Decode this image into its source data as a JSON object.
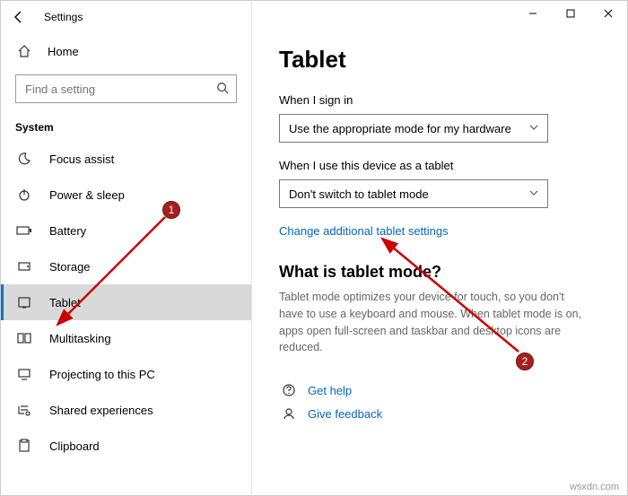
{
  "header": {
    "app_title": "Settings"
  },
  "home_label": "Home",
  "search": {
    "placeholder": "Find a setting"
  },
  "section_label": "System",
  "sidebar": {
    "items": [
      {
        "label": "Focus assist"
      },
      {
        "label": "Power & sleep"
      },
      {
        "label": "Battery"
      },
      {
        "label": "Storage"
      },
      {
        "label": "Tablet"
      },
      {
        "label": "Multitasking"
      },
      {
        "label": "Projecting to this PC"
      },
      {
        "label": "Shared experiences"
      },
      {
        "label": "Clipboard"
      }
    ]
  },
  "main": {
    "title": "Tablet",
    "signin_label": "When I sign in",
    "signin_value": "Use the appropriate mode for my hardware",
    "device_label": "When I use this device as a tablet",
    "device_value": "Don't switch to tablet mode",
    "change_link": "Change additional tablet settings",
    "subhead": "What is tablet mode?",
    "description": "Tablet mode optimizes your device for touch, so you don't have to use a keyboard and mouse. When tablet mode is on, apps open full-screen and taskbar and desktop icons are reduced.",
    "get_help": "Get help",
    "give_feedback": "Give feedback"
  },
  "annotations": {
    "badge1": "1",
    "badge2": "2"
  },
  "watermark": "wsxdn.com"
}
